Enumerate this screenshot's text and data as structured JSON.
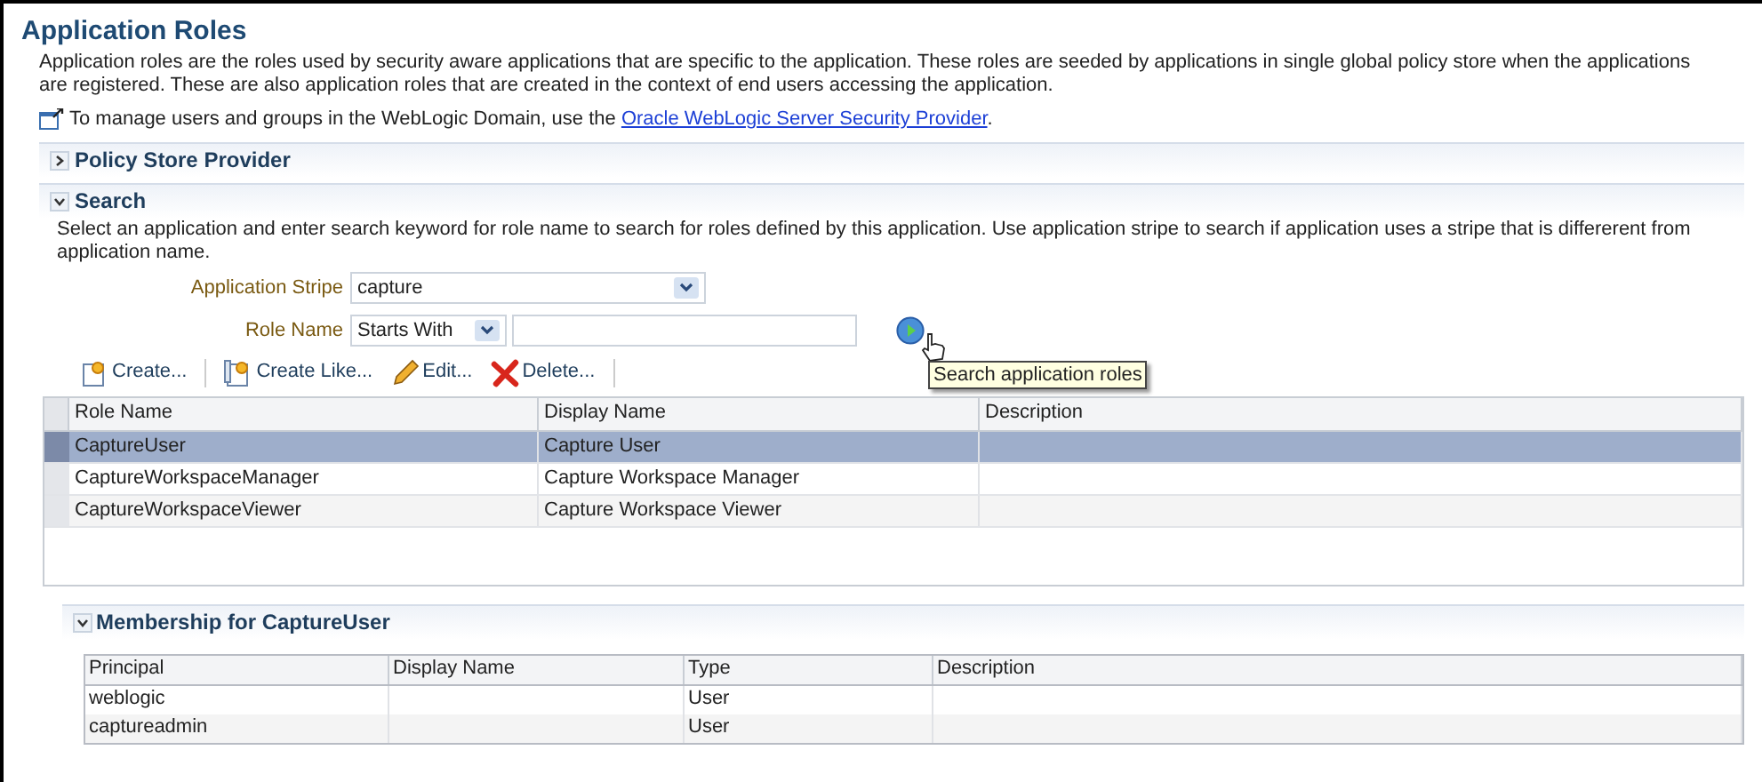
{
  "page": {
    "title": "Application Roles",
    "description": "Application roles are the roles used by security aware applications that are specific to the application. These roles are seeded by applications in single global policy store when the applications are registered. These are also application roles that are created in the context of end users accessing the application.",
    "manage_note": {
      "text": "To manage users and groups in the WebLogic Domain, use the",
      "link": "Oracle WebLogic Server Security Provider",
      "suffix": "."
    }
  },
  "policy_store_panel": {
    "title": "Policy Store Provider",
    "expanded": false
  },
  "search_panel": {
    "title": "Search",
    "expanded": true,
    "description": "Select an application and enter search keyword for role name to search for roles defined by this application. Use application stripe to search if application uses a stripe that is differerent from application name.",
    "application_stripe": {
      "label": "Application Stripe",
      "value": "capture"
    },
    "role_name": {
      "label": "Role Name",
      "operator": "Starts With"
    },
    "search_button": {
      "tooltip": "Search application roles"
    }
  },
  "toolbar": [
    {
      "kind": "create",
      "label": "Create..."
    },
    {
      "kind": "create_like",
      "label": "Create Like..."
    },
    {
      "kind": "edit",
      "label": "Edit..."
    },
    {
      "kind": "delete",
      "label": "Delete..."
    }
  ],
  "roles_table": {
    "columns": [
      "Role Name",
      "Display Name",
      "Description"
    ],
    "rows": [
      {
        "selected": true,
        "cells": [
          "CaptureUser",
          "Capture User"
        ]
      },
      {
        "selected": false,
        "cells": [
          "CaptureWorkspaceManager",
          "Capture Workspace Manager"
        ]
      },
      {
        "selected": false,
        "cells": [
          "CaptureWorkspaceViewer",
          "Capture Workspace Viewer"
        ]
      }
    ]
  },
  "membership_panel": {
    "title": "Membership for CaptureUser",
    "expanded": true,
    "columns": [
      "Principal",
      "Display Name",
      "Type",
      "Description"
    ],
    "rows": [
      {
        "cells": [
          "weblogic",
          "",
          "User",
          ""
        ]
      },
      {
        "cells": [
          "captureadmin",
          "",
          "User",
          ""
        ]
      }
    ]
  }
}
